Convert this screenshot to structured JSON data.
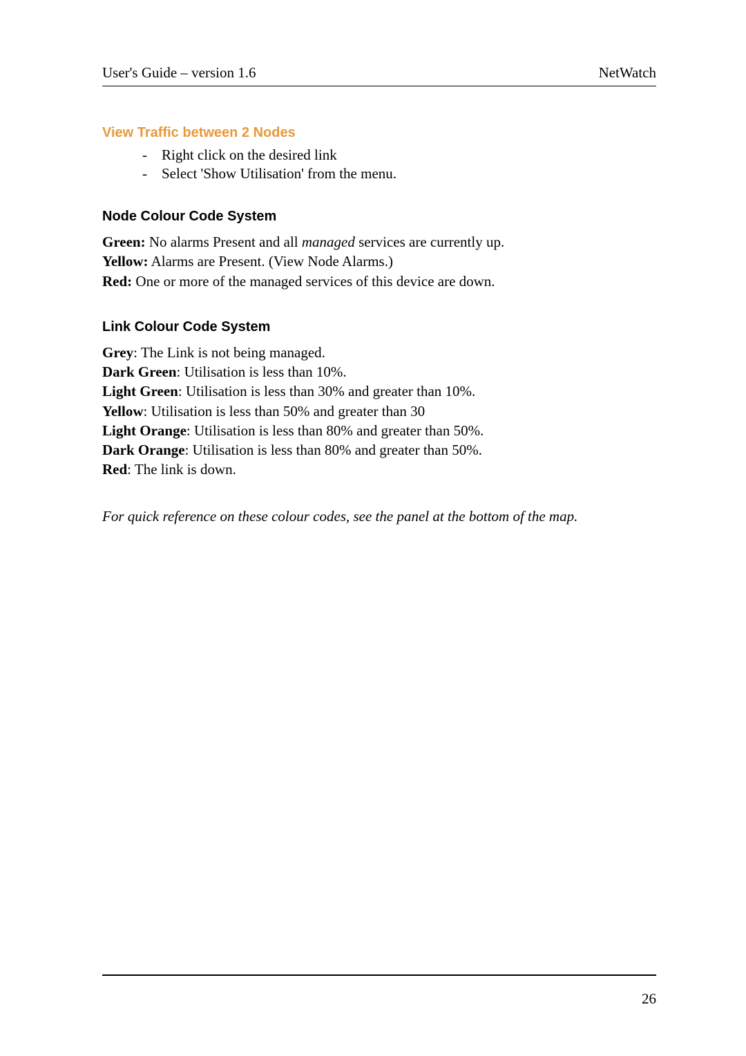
{
  "header": {
    "left": "User's Guide – version 1.6",
    "right": "NetWatch"
  },
  "section1": {
    "title": "View Traffic between 2 Nodes",
    "bullets": [
      "Right click on the desired link",
      "Select 'Show Utilisation' from the menu."
    ]
  },
  "section2": {
    "title": "Node Colour Code System",
    "items": [
      {
        "label": "Green:",
        "text": "  No alarms Present and all ",
        "italic": "managed",
        "rest": " services are currently up."
      },
      {
        "label": "Yellow:",
        "text": "  Alarms are Present. (View Node Alarms.)"
      },
      {
        "label": "Red:",
        "text": "  One or more of the managed services of this device are down."
      }
    ]
  },
  "section3": {
    "title": "Link Colour Code System",
    "items": [
      {
        "label": "Grey",
        "text": ":  The Link is not being managed."
      },
      {
        "label": "Dark Green",
        "text": ": Utilisation is less than 10%."
      },
      {
        "label": "Light Green",
        "text": ": Utilisation is less than 30% and greater than 10%."
      },
      {
        "label": "Yellow",
        "text": ": Utilisation is less than 50% and greater than 30"
      },
      {
        "label": "Light Orange",
        "text": ": Utilisation is less than 80% and greater than 50%."
      },
      {
        "label": "Dark Orange",
        "text": ": Utilisation is less than 80% and greater than 50%."
      },
      {
        "label": "Red",
        "text": ": The link is down."
      }
    ]
  },
  "footnote": "For quick reference on these colour codes, see the panel at the bottom of the map.",
  "pageNumber": "26"
}
